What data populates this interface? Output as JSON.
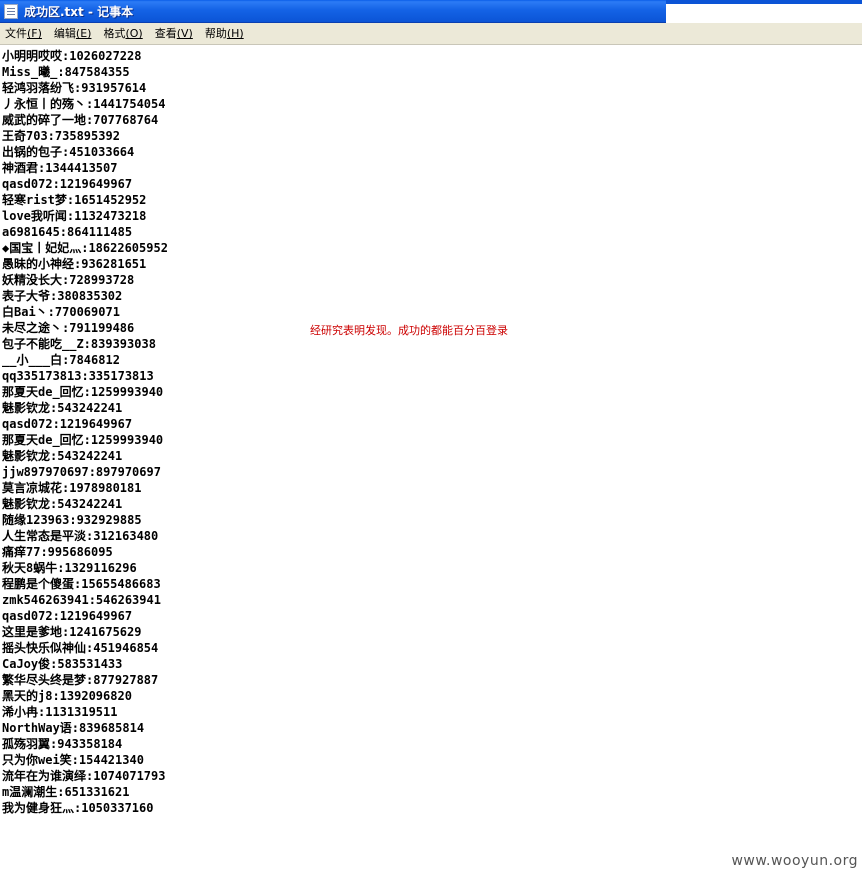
{
  "window": {
    "title": "成功区.txt - 记事本"
  },
  "menubar": {
    "items": [
      {
        "label": "文件",
        "accel": "(F)"
      },
      {
        "label": "编辑",
        "accel": "(E)"
      },
      {
        "label": "格式",
        "accel": "(O)"
      },
      {
        "label": "查看",
        "accel": "(V)"
      },
      {
        "label": "帮助",
        "accel": "(H)"
      }
    ]
  },
  "document": {
    "lines": [
      "小明明哎哎:1026027228",
      "Miss_曦_:847584355",
      "轻鸿羽落纷飞:931957614",
      "丿永恒丨的殇丶:1441754054",
      "威武的碎了一地:707768764",
      "王奇703:735895392",
      "出锅的包子:451033664",
      "神酒君:1344413507",
      "qasd072:1219649967",
      "轻寒rist梦:1651452952",
      "love我听闻:1132473218",
      "a6981645:864111485",
      "◆国宝丨妃妃灬:18622605952",
      "愚昧的小神经:936281651",
      "妖精没长大:728993728",
      "表子大爷:380835302",
      "白Bai丶:770069071",
      "未尽之途丶:791199486",
      "包子不能吃__Z:839393038",
      "__小___白:7846812",
      "qq335173813:335173813",
      "那夏天de_回忆:1259993940",
      "魅影钦龙:543242241",
      "qasd072:1219649967",
      "那夏天de_回忆:1259993940",
      "魅影钦龙:543242241",
      "jjw897970697:897970697",
      "莫言凉城花:1978980181",
      "魅影钦龙:543242241",
      "随缘123963:932929885",
      "人生常态是平淡:312163480",
      "痛痒77:995686095",
      "秋天8蜗牛:1329116296",
      "程鹏是个傻蛋:15655486683",
      "zmk546263941:546263941",
      "qasd072:1219649967",
      "这里是爹地:1241675629",
      "摇头快乐似神仙:451946854",
      "CaJoy俊:583531433",
      "繁华尽头终是梦:877927887",
      "黑天的j8:1392096820",
      "浠小冉:1131319511",
      "NorthWay语:839685814",
      "孤殇羽翼:943358184",
      "只为你wei笑:154421340",
      "流年在为谁演绎:1074071793",
      "m温澜潮生:651331621",
      "我为健身狂灬:1050337160"
    ]
  },
  "annotation": {
    "text": "经研究表明发现。成功的都能百分百登录",
    "color": "#cc0000"
  },
  "watermark": {
    "text": "www.wooyun.org"
  },
  "colors": {
    "titlebar": "#0b54d6",
    "menubar": "#ece9d8",
    "text": "#000000"
  }
}
